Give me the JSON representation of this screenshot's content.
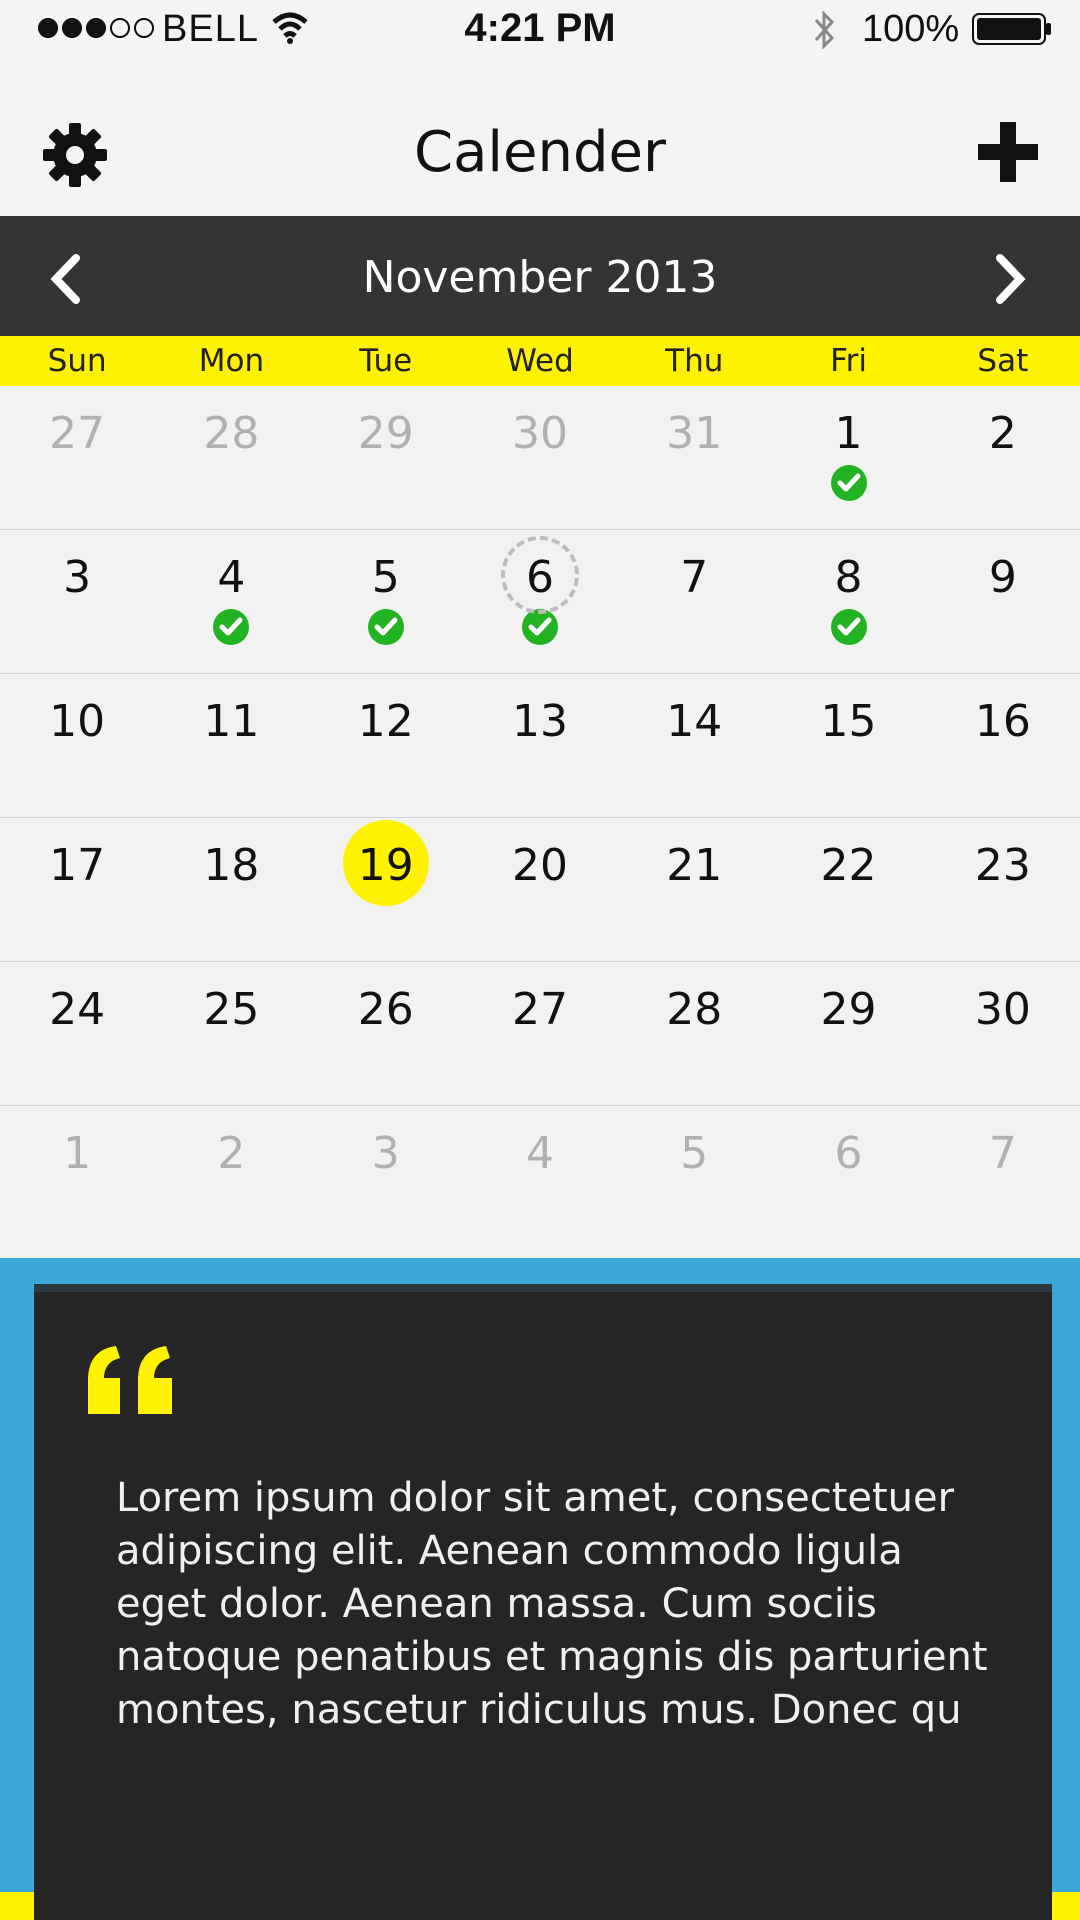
{
  "status_bar": {
    "carrier": "BELL",
    "time": "4:21 PM",
    "battery": "100%"
  },
  "nav": {
    "title": "Calender",
    "left_icon": "gear-icon",
    "right_icon": "plus-icon"
  },
  "calendar": {
    "month_label": "November 2013",
    "weekdays": [
      "Sun",
      "Mon",
      "Tue",
      "Wed",
      "Thu",
      "Fri",
      "Sat"
    ],
    "weeks": [
      [
        {
          "n": "27",
          "muted": true
        },
        {
          "n": "28",
          "muted": true
        },
        {
          "n": "29",
          "muted": true
        },
        {
          "n": "30",
          "muted": true
        },
        {
          "n": "31",
          "muted": true
        },
        {
          "n": "1",
          "check": true
        },
        {
          "n": "2"
        }
      ],
      [
        {
          "n": "3"
        },
        {
          "n": "4",
          "check": true
        },
        {
          "n": "5",
          "check": true
        },
        {
          "n": "6",
          "check": true,
          "dashed": true
        },
        {
          "n": "7"
        },
        {
          "n": "8",
          "check": true
        },
        {
          "n": "9"
        }
      ],
      [
        {
          "n": "10"
        },
        {
          "n": "11"
        },
        {
          "n": "12"
        },
        {
          "n": "13"
        },
        {
          "n": "14"
        },
        {
          "n": "15"
        },
        {
          "n": "16"
        }
      ],
      [
        {
          "n": "17"
        },
        {
          "n": "18"
        },
        {
          "n": "19",
          "today": true
        },
        {
          "n": "20"
        },
        {
          "n": "21"
        },
        {
          "n": "22"
        },
        {
          "n": "23"
        }
      ],
      [
        {
          "n": "24"
        },
        {
          "n": "25"
        },
        {
          "n": "26"
        },
        {
          "n": "27"
        },
        {
          "n": "28"
        },
        {
          "n": "29"
        },
        {
          "n": "30"
        }
      ],
      [
        {
          "n": "1",
          "muted": true
        },
        {
          "n": "2",
          "muted": true
        },
        {
          "n": "3",
          "muted": true
        },
        {
          "n": "4",
          "muted": true
        },
        {
          "n": "5",
          "muted": true
        },
        {
          "n": "6",
          "muted": true
        },
        {
          "n": "7",
          "muted": true
        }
      ]
    ]
  },
  "quote": {
    "text": "Lorem ipsum dolor sit amet, consectetuer adipiscing elit. Aenean commodo ligula eget dolor. Aenean massa. Cum sociis natoque penatibus et magnis dis parturient montes, nascetur ridiculus mus. Donec qu"
  },
  "colors": {
    "accent_yellow": "#fff200",
    "header_dark": "#343434",
    "check_green": "#21b321",
    "quote_bg": "#252525",
    "frame_blue": "#3aa7d8"
  }
}
